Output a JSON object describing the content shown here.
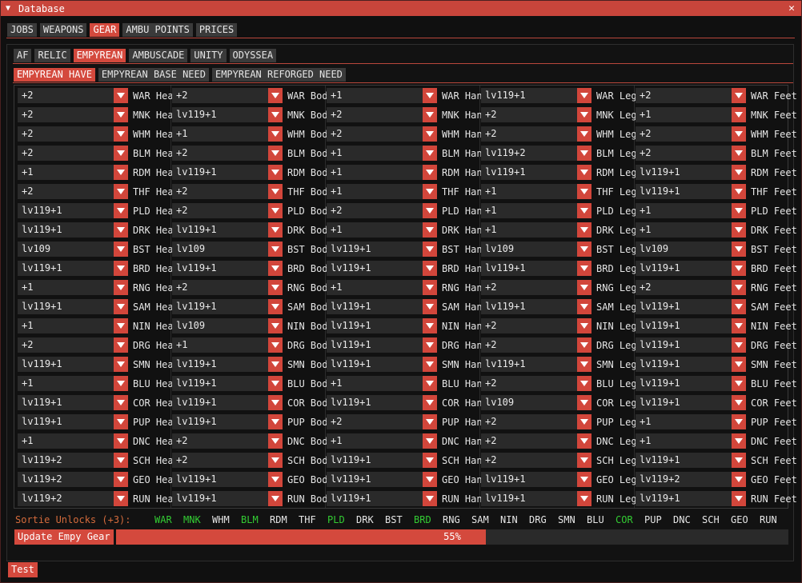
{
  "window": {
    "title": "Database"
  },
  "tabs": {
    "main": [
      "JOBS",
      "WEAPONS",
      "GEAR",
      "AMBU POINTS",
      "PRICES"
    ],
    "main_active": 2,
    "gear": [
      "AF",
      "RELIC",
      "EMPYREAN",
      "AMBUSCADE",
      "UNITY",
      "ODYSSEA"
    ],
    "gear_active": 2,
    "empyrean": [
      "EMPYREAN HAVE",
      "EMPYREAN BASE NEED",
      "EMPYREAN REFORGED NEED"
    ],
    "empyrean_active": 0
  },
  "slots": [
    "Head",
    "Body",
    "Hands",
    "Legs",
    "Feet"
  ],
  "rows": [
    {
      "job": "WAR",
      "values": [
        "+2",
        "+2",
        "+1",
        "lv119+1",
        "+2"
      ]
    },
    {
      "job": "MNK",
      "values": [
        "+2",
        "lv119+1",
        "+2",
        "+2",
        "+1"
      ]
    },
    {
      "job": "WHM",
      "values": [
        "+2",
        "+1",
        "+2",
        "+2",
        "+2"
      ]
    },
    {
      "job": "BLM",
      "values": [
        "+2",
        "+2",
        "+1",
        "lv119+2",
        "+2"
      ]
    },
    {
      "job": "RDM",
      "values": [
        "+1",
        "lv119+1",
        "+1",
        "lv119+1",
        "lv119+1"
      ]
    },
    {
      "job": "THF",
      "values": [
        "+2",
        "+2",
        "+1",
        "+1",
        "lv119+1"
      ]
    },
    {
      "job": "PLD",
      "values": [
        "lv119+1",
        "+2",
        "+2",
        "+1",
        "+1"
      ]
    },
    {
      "job": "DRK",
      "values": [
        "lv119+1",
        "lv119+1",
        "+1",
        "+1",
        "+1"
      ]
    },
    {
      "job": "BST",
      "values": [
        "lv109",
        "lv109",
        "lv119+1",
        "lv109",
        "lv109"
      ]
    },
    {
      "job": "BRD",
      "values": [
        "lv119+1",
        "lv119+1",
        "lv119+1",
        "lv119+1",
        "lv119+1"
      ]
    },
    {
      "job": "RNG",
      "values": [
        "+1",
        "+2",
        "+1",
        "+2",
        "+2"
      ]
    },
    {
      "job": "SAM",
      "values": [
        "lv119+1",
        "lv119+1",
        "lv119+1",
        "lv119+1",
        "lv119+1"
      ]
    },
    {
      "job": "NIN",
      "values": [
        "+1",
        "lv109",
        "lv119+1",
        "+2",
        "lv119+1"
      ]
    },
    {
      "job": "DRG",
      "values": [
        "+2",
        "+1",
        "lv119+1",
        "+2",
        "lv119+1"
      ]
    },
    {
      "job": "SMN",
      "values": [
        "lv119+1",
        "lv119+1",
        "lv119+1",
        "lv119+1",
        "lv119+1"
      ]
    },
    {
      "job": "BLU",
      "values": [
        "+1",
        "lv119+1",
        "+1",
        "+2",
        "lv119+1"
      ]
    },
    {
      "job": "COR",
      "values": [
        "lv119+1",
        "lv119+1",
        "lv119+1",
        "lv109",
        "lv119+1"
      ]
    },
    {
      "job": "PUP",
      "values": [
        "lv119+1",
        "lv119+1",
        "+2",
        "+2",
        "+1"
      ]
    },
    {
      "job": "DNC",
      "values": [
        "+1",
        "+2",
        "+1",
        "+2",
        "+1"
      ]
    },
    {
      "job": "SCH",
      "values": [
        "lv119+2",
        "+2",
        "lv119+1",
        "+2",
        "lv119+1"
      ]
    },
    {
      "job": "GEO",
      "values": [
        "lv119+2",
        "lv119+1",
        "lv119+1",
        "lv119+1",
        "lv119+2"
      ]
    },
    {
      "job": "RUN",
      "values": [
        "lv119+2",
        "lv119+1",
        "lv119+1",
        "lv119+1",
        "lv119+1"
      ]
    }
  ],
  "sortie": {
    "label": "Sortie Unlocks (+3):",
    "jobs": [
      {
        "name": "WAR",
        "unlocked": true
      },
      {
        "name": "MNK",
        "unlocked": true
      },
      {
        "name": "WHM",
        "unlocked": false
      },
      {
        "name": "BLM",
        "unlocked": true
      },
      {
        "name": "RDM",
        "unlocked": false
      },
      {
        "name": "THF",
        "unlocked": false
      },
      {
        "name": "PLD",
        "unlocked": true
      },
      {
        "name": "DRK",
        "unlocked": false
      },
      {
        "name": "BST",
        "unlocked": false
      },
      {
        "name": "BRD",
        "unlocked": true
      },
      {
        "name": "RNG",
        "unlocked": false
      },
      {
        "name": "SAM",
        "unlocked": false
      },
      {
        "name": "NIN",
        "unlocked": false
      },
      {
        "name": "DRG",
        "unlocked": false
      },
      {
        "name": "SMN",
        "unlocked": false
      },
      {
        "name": "BLU",
        "unlocked": false
      },
      {
        "name": "COR",
        "unlocked": true
      },
      {
        "name": "PUP",
        "unlocked": false
      },
      {
        "name": "DNC",
        "unlocked": false
      },
      {
        "name": "SCH",
        "unlocked": false
      },
      {
        "name": "GEO",
        "unlocked": false
      },
      {
        "name": "RUN",
        "unlocked": false
      }
    ],
    "colors": {
      "unlocked": "#33cc33",
      "label": "#d46b3c"
    }
  },
  "update": {
    "button_label": "Update Empy Gear",
    "progress_percent": 55,
    "progress_text": "55%"
  },
  "test_button": "Test",
  "colors": {
    "accent": "#d4493d",
    "tab_inactive": "#3a3a3a",
    "field_bg": "#2a2a2a"
  }
}
